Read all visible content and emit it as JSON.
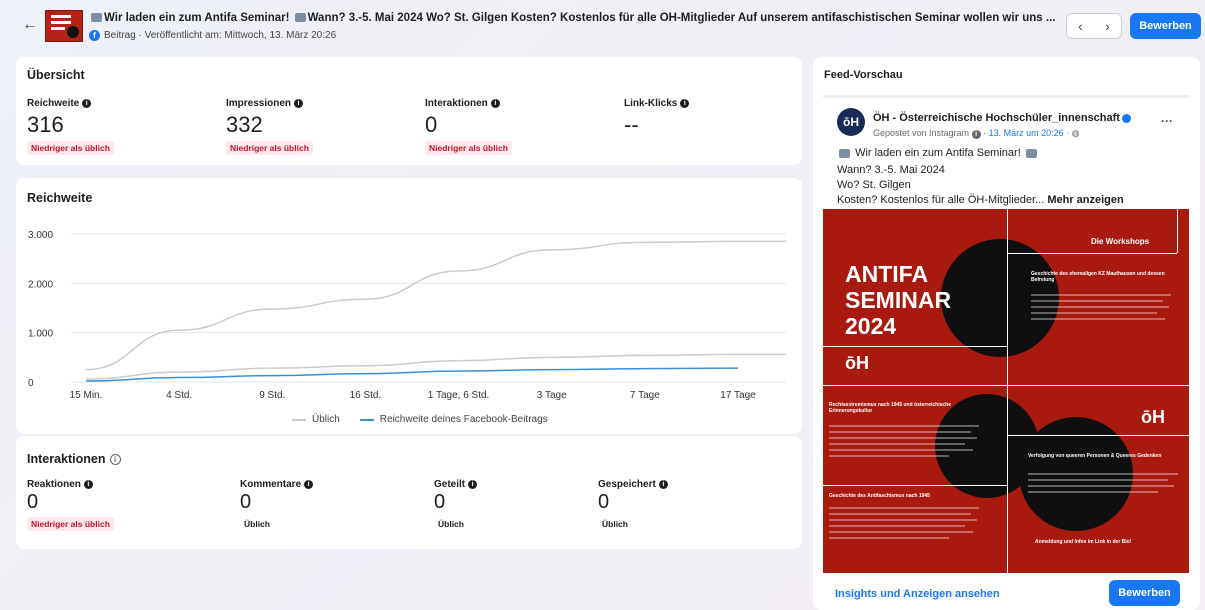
{
  "header": {
    "back_icon": "arrow-left-icon",
    "title_parts": [
      "Wir laden ein zum Antifa Seminar!",
      "Wann? 3.-5. Mai 2024 Wo? St. Gilgen Kosten? Kostenlos für alle ÖH-Mitglieder Auf unserem antifaschistischen Seminar wollen wir uns ..."
    ],
    "meta": "Beitrag · Veröffentlicht am: Mittwoch, 13. März 20:26",
    "prev_icon": "chevron-left-icon",
    "next_icon": "chevron-right-icon",
    "boost_label": "Bewerben"
  },
  "overview": {
    "title": "Übersicht",
    "metrics": [
      {
        "label": "Reichweite",
        "value": "316",
        "status": "Niedriger als üblich"
      },
      {
        "label": "Impressionen",
        "value": "332",
        "status": "Niedriger als üblich"
      },
      {
        "label": "Interaktionen",
        "value": "0",
        "status": "Niedriger als üblich"
      },
      {
        "label": "Link-Klicks",
        "value": "--",
        "status": ""
      }
    ]
  },
  "reach": {
    "title": "Reichweite",
    "legend_typical": "Üblich",
    "legend_post": "Reichweite deines Facebook-Beitrags"
  },
  "chart_data": {
    "type": "line",
    "title": "Reichweite",
    "x": [
      "15 Min.",
      "4 Std.",
      "9 Std.",
      "16 Std.",
      "1 Tage, 6 Std.",
      "3 Tage",
      "7 Tage",
      "17 Tage"
    ],
    "ylim": [
      0,
      3000
    ],
    "yticks": [
      "0",
      "1.000",
      "2.000",
      "3.000"
    ],
    "grid": true,
    "legend": "bottom",
    "series": [
      {
        "name": "Üblich",
        "color": "#c9cbcf",
        "values": [
          250,
          1050,
          1480,
          1680,
          2250,
          2680,
          2830,
          2850
        ]
      },
      {
        "name": "Üblich",
        "color": "#c9cbcf",
        "values": [
          60,
          200,
          280,
          330,
          430,
          500,
          540,
          560
        ]
      },
      {
        "name": "Reichweite deines Facebook-Beitrags",
        "color": "#3b8fd6",
        "values": [
          20,
          90,
          130,
          170,
          220,
          250,
          270,
          280
        ]
      }
    ]
  },
  "interactions": {
    "title": "Interaktionen",
    "metrics": [
      {
        "label": "Reaktionen",
        "value": "0",
        "status": "Niedriger als üblich",
        "status_type": "red"
      },
      {
        "label": "Kommentare",
        "value": "0",
        "status": "Üblich",
        "status_type": "plain"
      },
      {
        "label": "Geteilt",
        "value": "0",
        "status": "Üblich",
        "status_type": "plain"
      },
      {
        "label": "Gespeichert",
        "value": "0",
        "status": "Üblich",
        "status_type": "plain"
      }
    ]
  },
  "feed": {
    "title": "Feed-Vorschau",
    "avatar": "ōH",
    "page_name": "ÖH - Österreichische Hochschüler_innenschaft",
    "posted_prefix": "Gepostet von Instagram",
    "posted_date": "13. März um 20:26",
    "more_icon": "more-dots-icon",
    "line1": "Wir laden ein zum Antifa Seminar!",
    "line2": "Wann? 3.-5. Mai 2024",
    "line3": "Wo? St. Gilgen",
    "line4": "Kosten? Kostenlos für alle ÖH-Mitglieder...",
    "more_label": "Mehr anzeigen",
    "insights_link": "Insights und Anzeigen ansehen",
    "boost_label": "Bewerben"
  },
  "poster": {
    "headline": "ANTIFA\nSEMINAR\n2024",
    "workshops": "Die Workshops",
    "logo": "ōH",
    "w1": "Geschichte des ehemaligen KZ Mauthausen und dessen Befreiung",
    "w2": "Rechtsextremismus nach 1945 und österreichische Erinnerungskultur",
    "w3": "Verfolgung von queeren Personen & Queeres Gedenken",
    "w4": "Geschichte des Antifaschismus nach 1945",
    "footer": "Anmeldung und Infos im Link in der Bio!",
    "colors": {
      "background": "#a8190e",
      "circle": "#0f0f0f"
    }
  }
}
